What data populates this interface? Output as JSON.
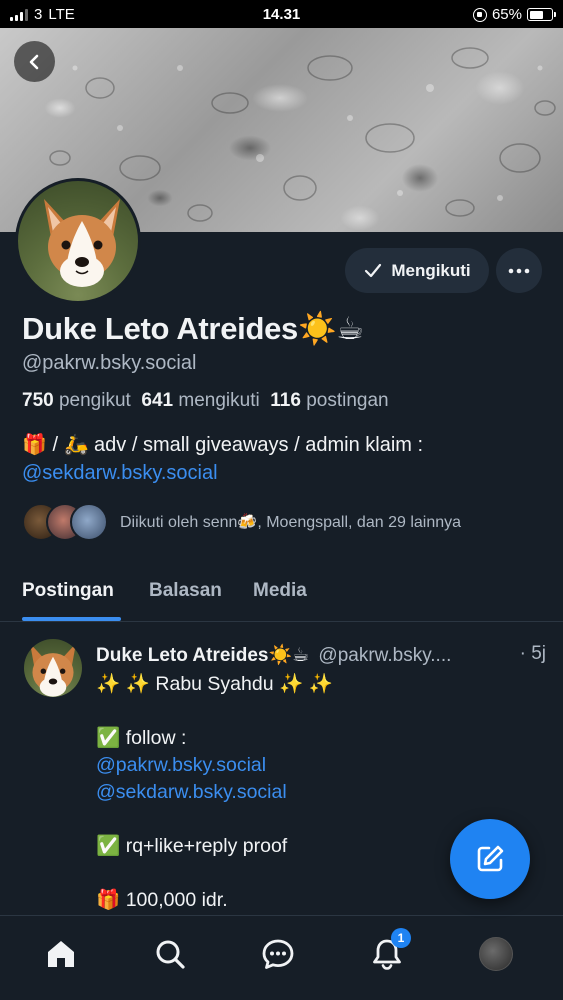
{
  "status_bar": {
    "carrier": "3",
    "network": "LTE",
    "time": "14.31",
    "battery_percent": "65%",
    "battery_level": 0.65
  },
  "profile": {
    "display_name": "Duke Leto Atreides☀️☕",
    "handle": "@pakrw.bsky.social",
    "follow_button_label": "Mengikuti",
    "stats": {
      "followers_count": "750",
      "followers_label": "pengikut",
      "following_count": "641",
      "following_label": "mengikuti",
      "posts_count": "116",
      "posts_label": "postingan"
    },
    "bio_line1": "🎁 / 🛵 adv / small giveaways / admin klaim :",
    "bio_mention": "@sekdarw.bsky.social",
    "followed_by_text": "Diikuti oleh senn🍻, Moengspall, dan 29 lainnya"
  },
  "tabs": [
    {
      "label": "Postingan",
      "active": true
    },
    {
      "label": "Balasan",
      "active": false
    },
    {
      "label": "Media",
      "active": false
    }
  ],
  "post": {
    "author_name": "Duke Leto Atreides☀️☕",
    "author_handle": "@pakrw.bsky....",
    "time": "· 5j",
    "line1": "✨ ✨  Rabu Syahdu ✨ ✨",
    "line2": "✅ follow :",
    "mention1": "@pakrw.bsky.social",
    "mention2": "@sekdarw.bsky.social",
    "line3": "✅ rq+like+reply proof",
    "line4": "🎁 100,000 idr."
  },
  "bottom_nav": {
    "items": [
      "home-icon",
      "search-icon",
      "chat-icon",
      "bell-icon",
      "profile-avatar"
    ],
    "notification_badge": "1"
  },
  "colors": {
    "background": "#161e27",
    "accent": "#1f83f2",
    "link": "#3b8ef0",
    "muted_text": "#aeb8c4"
  }
}
